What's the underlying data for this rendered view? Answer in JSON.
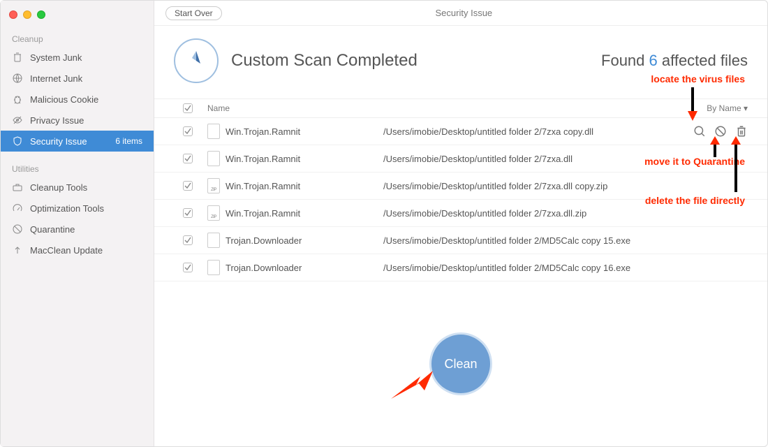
{
  "sidebar": {
    "sections": {
      "cleanup_label": "Cleanup",
      "utilities_label": "Utilities"
    },
    "items": [
      {
        "label": "System Junk"
      },
      {
        "label": "Internet Junk"
      },
      {
        "label": "Malicious Cookie"
      },
      {
        "label": "Privacy Issue"
      },
      {
        "label": "Security Issue",
        "count": "6 items"
      },
      {
        "label": "Cleanup Tools"
      },
      {
        "label": "Optimization Tools"
      },
      {
        "label": "Quarantine"
      },
      {
        "label": "MacClean Update"
      }
    ]
  },
  "topbar": {
    "start_over": "Start Over",
    "title": "Security Issue"
  },
  "header": {
    "title": "Custom Scan Completed",
    "found_prefix": "Found ",
    "found_count": "6",
    "found_suffix": " affected files"
  },
  "table": {
    "name_header": "Name",
    "sort_label": "By Name ▾",
    "rows": [
      {
        "name": "Win.Trojan.Ramnit",
        "path": "/Users/imobie/Desktop/untitled folder 2/7zxa copy.dll",
        "zip": false,
        "showActions": true
      },
      {
        "name": "Win.Trojan.Ramnit",
        "path": "/Users/imobie/Desktop/untitled folder 2/7zxa.dll",
        "zip": false,
        "showActions": false
      },
      {
        "name": "Win.Trojan.Ramnit",
        "path": "/Users/imobie/Desktop/untitled folder 2/7zxa.dll copy.zip",
        "zip": true,
        "showActions": false
      },
      {
        "name": "Win.Trojan.Ramnit",
        "path": "/Users/imobie/Desktop/untitled folder 2/7zxa.dll.zip",
        "zip": true,
        "showActions": false
      },
      {
        "name": "Trojan.Downloader",
        "path": "/Users/imobie/Desktop/untitled folder 2/MD5Calc copy 15.exe",
        "zip": false,
        "showActions": false
      },
      {
        "name": "Trojan.Downloader",
        "path": "/Users/imobie/Desktop/untitled folder 2/MD5Calc copy 16.exe",
        "zip": false,
        "showActions": false
      }
    ]
  },
  "actions": {
    "clean": "Clean"
  },
  "annotations": {
    "locate": "locate the virus files",
    "quarantine": "move it to Quarantine",
    "delete": "delete the file directly"
  }
}
